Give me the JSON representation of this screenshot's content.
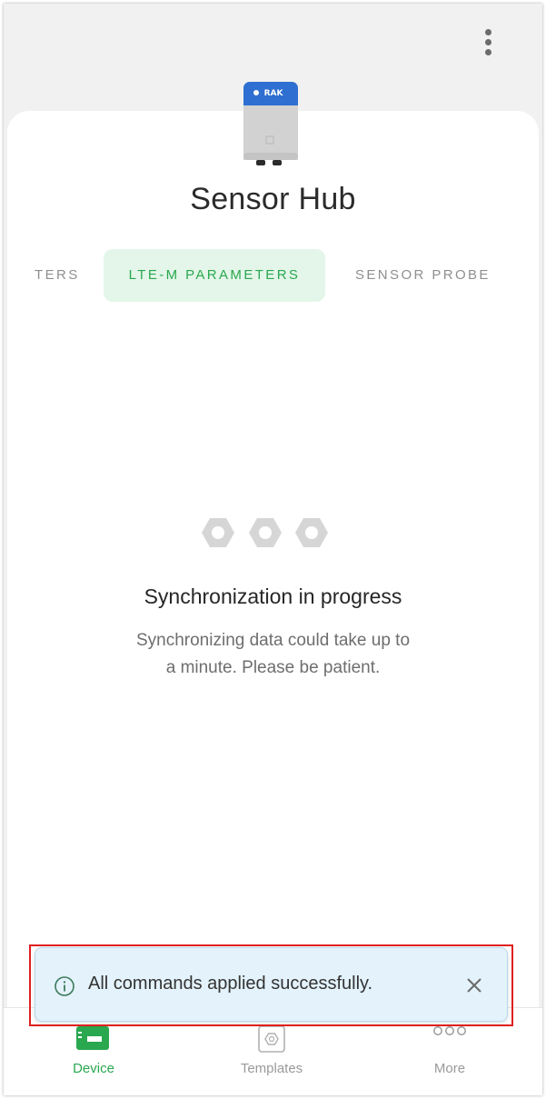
{
  "header": {
    "menu_icon": "more-vertical-icon"
  },
  "device": {
    "image_icon": "rak-device-icon",
    "brand": "RAK",
    "title": "Sensor Hub"
  },
  "tabs": [
    {
      "label": "TERS",
      "active": false
    },
    {
      "label": "LTE-M PARAMETERS",
      "active": true
    },
    {
      "label": "SENSOR PROBE",
      "active": false
    }
  ],
  "sync": {
    "title": "Synchronization in progress",
    "line1": "Synchronizing data could take up to",
    "line2": "a minute. Please be patient."
  },
  "nav": [
    {
      "label": "Device",
      "icon": "device-icon",
      "active": true
    },
    {
      "label": "Templates",
      "icon": "templates-icon",
      "active": false
    },
    {
      "label": "More",
      "icon": "more-horizontal-icon",
      "active": false
    }
  ],
  "toast": {
    "message": "All commands applied successfully.",
    "icon": "info-icon",
    "close_icon": "close-icon"
  },
  "colors": {
    "accent": "#2aa84f",
    "tab_active_bg": "#e3f6e9",
    "toast_bg": "#e3f2fb",
    "highlight": "#e02020"
  }
}
